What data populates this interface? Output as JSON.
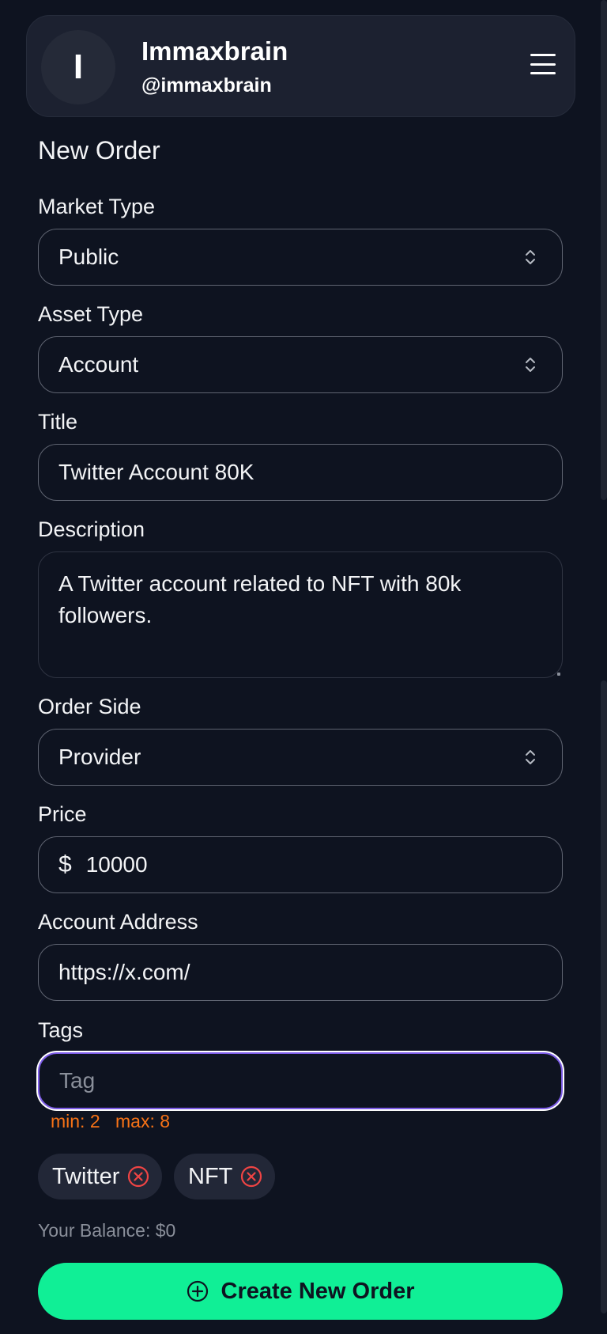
{
  "header": {
    "avatar_initial": "I",
    "user_name": "Immaxbrain",
    "user_handle": "@immaxbrain",
    "menu_icon": "hamburger-menu-icon"
  },
  "form": {
    "title": "New Order",
    "market_type": {
      "label": "Market Type",
      "value": "Public"
    },
    "asset_type": {
      "label": "Asset Type",
      "value": "Account"
    },
    "title_field": {
      "label": "Title",
      "value": "Twitter Account 80K"
    },
    "description": {
      "label": "Description",
      "value": "A Twitter account related to NFT with 80k followers."
    },
    "order_side": {
      "label": "Order Side",
      "value": "Provider"
    },
    "price": {
      "label": "Price",
      "currency": "$",
      "value": "10000"
    },
    "account_address": {
      "label": "Account Address",
      "value": "https://x.com/"
    },
    "tags": {
      "label": "Tags",
      "placeholder": "Tag",
      "hint_min": "min: 2",
      "hint_max": "max: 8",
      "items": [
        "Twitter",
        "NFT"
      ]
    },
    "balance": "Your Balance: $0",
    "submit_label": "Create New Order"
  },
  "colors": {
    "background": "#0e1320",
    "accent_green": "#10ef96",
    "hint_orange": "#f97316",
    "remove_red": "#ef4444",
    "focus_purple": "#7c5ce6"
  }
}
